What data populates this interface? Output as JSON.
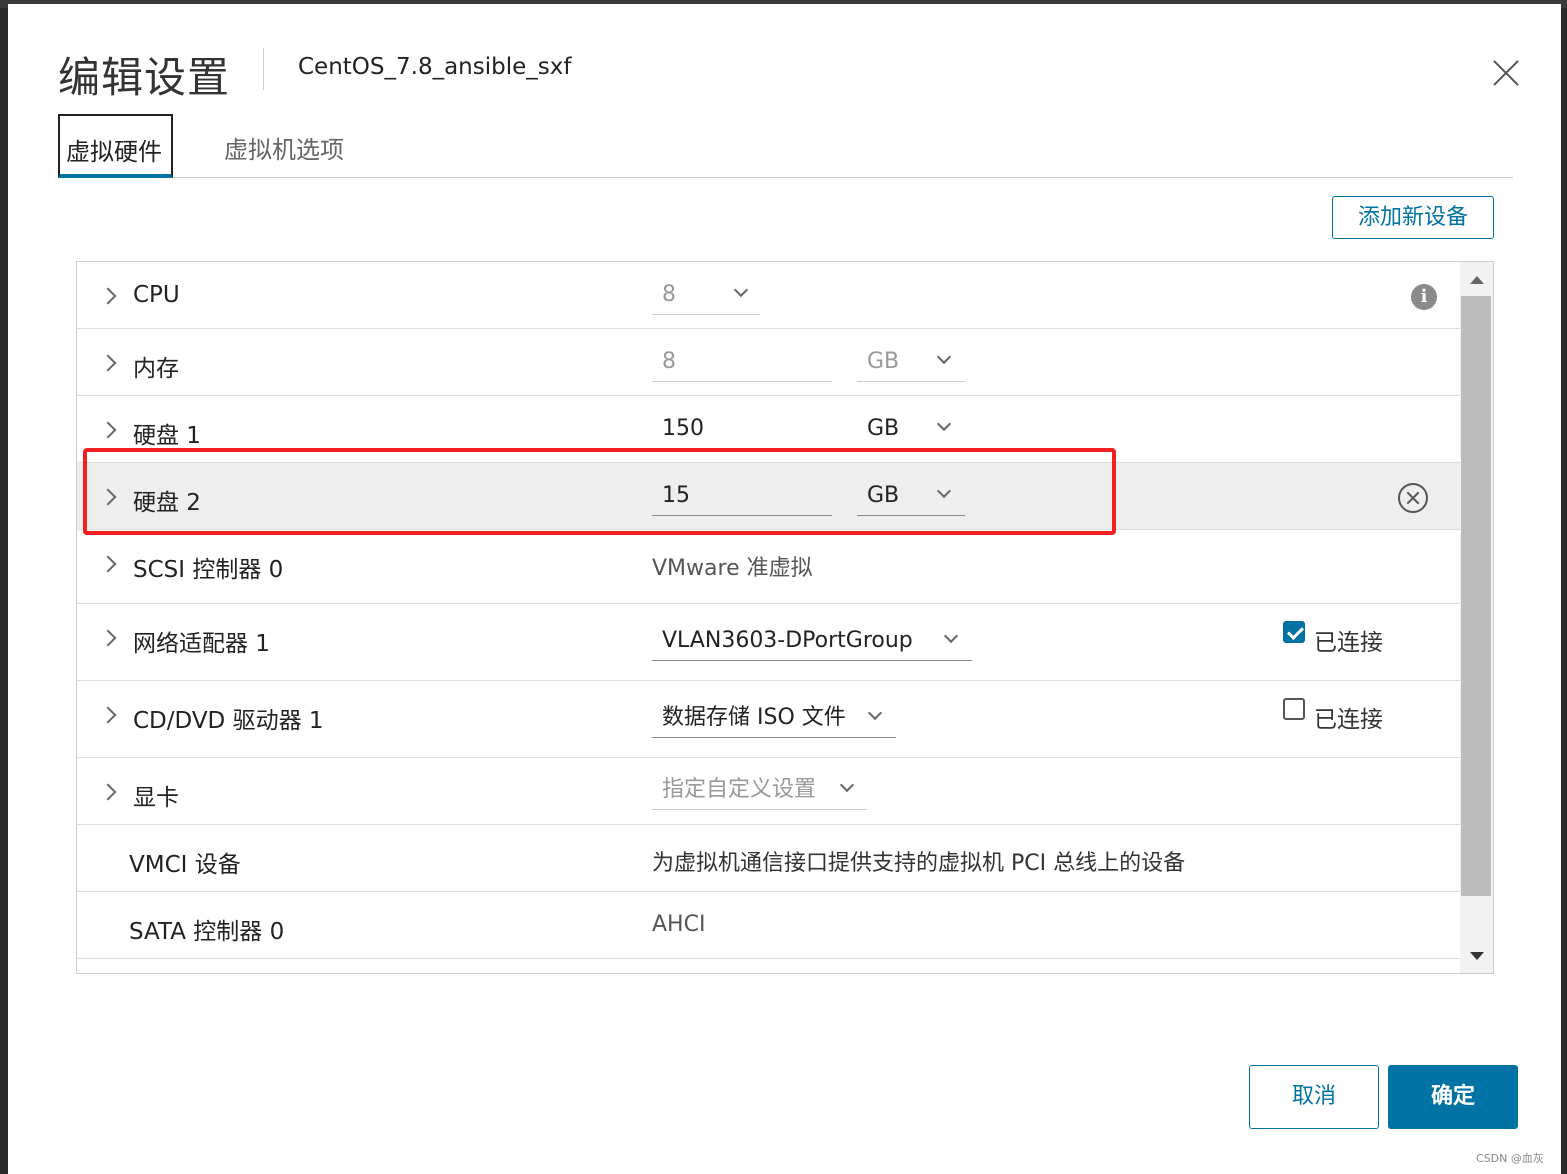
{
  "dialog": {
    "title": "编辑设置",
    "vm_name": "CentOS_7.8_ansible_sxf"
  },
  "tabs": [
    {
      "label": "虚拟硬件",
      "active": true
    },
    {
      "label": "虚拟机选项",
      "active": false
    }
  ],
  "toolbar": {
    "add_device_label": "添加新设备"
  },
  "hardware": {
    "cpu": {
      "label": "CPU",
      "value": "8"
    },
    "memory": {
      "label": "内存",
      "value": "8",
      "unit": "GB"
    },
    "disk1": {
      "label": "硬盘 1",
      "value": "150",
      "unit": "GB"
    },
    "disk2": {
      "label": "硬盘 2",
      "value": "15",
      "unit": "GB"
    },
    "scsi": {
      "label": "SCSI 控制器 0",
      "value": "VMware 准虚拟"
    },
    "network": {
      "label": "网络适配器 1",
      "value": "VLAN3603-DPortGroup",
      "connected_label": "已连接",
      "connected": true
    },
    "cdrom": {
      "label": "CD/DVD 驱动器 1",
      "value": "数据存储 ISO 文件",
      "connected_label": "已连接",
      "connected": false
    },
    "video": {
      "label": "显卡",
      "value": "指定自定义设置"
    },
    "vmci": {
      "label": "VMCI 设备",
      "value": "为虚拟机通信接口提供支持的虚拟机 PCI 总线上的设备"
    },
    "sata": {
      "label": "SATA 控制器 0",
      "value": "AHCI"
    }
  },
  "footer": {
    "cancel_label": "取消",
    "ok_label": "确定"
  },
  "watermark": "CSDN @血灰",
  "colors": {
    "accent": "#0072a3",
    "highlight_border": "#f02020"
  }
}
